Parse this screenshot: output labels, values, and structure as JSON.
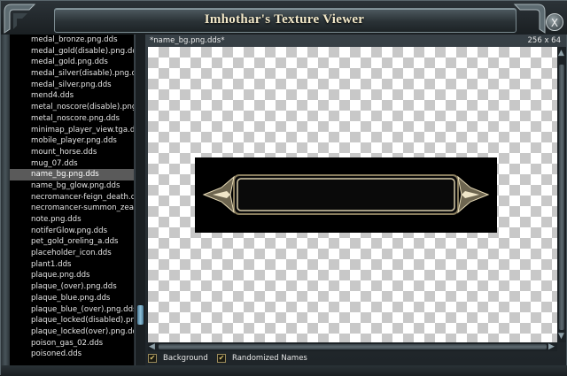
{
  "window": {
    "title": "Imhothar's Texture Viewer",
    "close_label": "X"
  },
  "file_list": {
    "items": [
      "medal_bronze.png.dds",
      "medal_gold(disable).png.dds",
      "medal_gold.png.dds",
      "medal_silver(disable).png.dds",
      "medal_silver.png.dds",
      "mend4.dds",
      "metal_noscore(disable).png.dds",
      "metal_noscore.png.dds",
      "minimap_player_view.tga.dds",
      "mobile_player.png.dds",
      "mount_horse.dds",
      "mug_07.dds",
      "name_bg.png.dds",
      "name_bg_glow.png.dds",
      "necromancer-feign_death.dds",
      "necromancer-summon_zealot_a.d",
      "note.png.dds",
      "notiferGlow.png.dds",
      "pet_gold_oreling_a.dds",
      "placeholder_icon.dds",
      "plant1.dds",
      "plaque.png.dds",
      "plaque_(over).png.dds",
      "plaque_blue.png.dds",
      "plaque_blue_(over).png.dds",
      "plaque_locked(disabled).png.dds",
      "plaque_locked(over).png.dds",
      "poison_gas_02.dds",
      "poisoned.dds"
    ],
    "selected_index": 12
  },
  "preview": {
    "texture_name": "*name_bg.png.dds*",
    "texture_size": "256 x 64"
  },
  "options": {
    "background_label": "Background",
    "background_checked": true,
    "randomized_names_label": "Randomized Names",
    "randomized_names_checked": true
  },
  "colors": {
    "title_text": "#f2e8c8",
    "selected_row": "#5a5a5a",
    "texture_border": "#c8b98a"
  }
}
